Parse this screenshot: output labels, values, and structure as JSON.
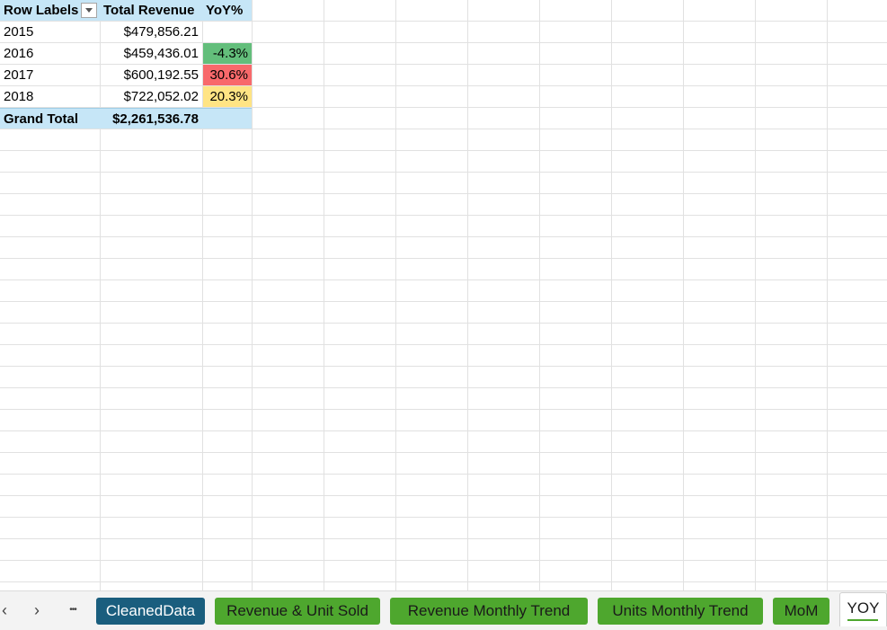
{
  "pivot": {
    "header": {
      "row_labels": "Row Labels",
      "total_revenue": "Total Revenue",
      "yoy": "YoY%"
    },
    "rows": [
      {
        "year": "2015",
        "revenue": "$479,856.21",
        "yoy": ""
      },
      {
        "year": "2016",
        "revenue": "$459,436.01",
        "yoy": "-4.3%"
      },
      {
        "year": "2017",
        "revenue": "$600,192.55",
        "yoy": "30.6%"
      },
      {
        "year": "2018",
        "revenue": "$722,052.02",
        "yoy": "20.3%"
      }
    ],
    "grand_total": {
      "label": "Grand Total",
      "revenue": "$2,261,536.78"
    }
  },
  "colors": {
    "pivot_header": "#c6e6f7",
    "yoy_negative_cell": "#63be7b",
    "yoy_high_cell": "#f8696b",
    "yoy_mid_cell": "#ffe484",
    "tab_green": "#4ea72e",
    "tab_blue": "#1a5e7e"
  },
  "tabbar": {
    "prev_icon": "‹",
    "next_icon": "›",
    "more_icon": "•••",
    "tabs": [
      {
        "label": "CleanedData"
      },
      {
        "label": "Revenue & Unit Sold"
      },
      {
        "label": "Revenue Monthly Trend"
      },
      {
        "label": "Units Monthly Trend"
      },
      {
        "label": "MoM"
      },
      {
        "label": "YOY"
      }
    ],
    "active_tab": "YOY"
  }
}
